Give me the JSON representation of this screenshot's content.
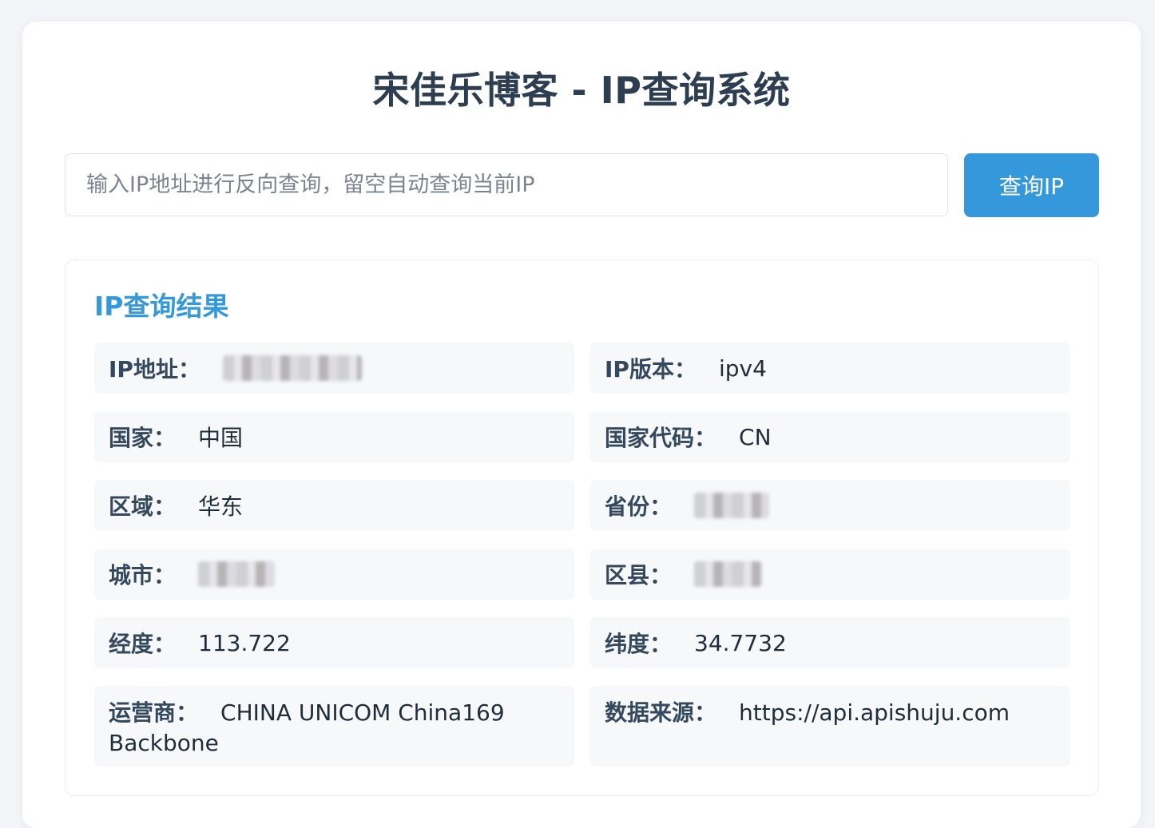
{
  "page": {
    "title": "宋佳乐博客 - IP查询系统"
  },
  "search": {
    "value": "",
    "placeholder": "输入IP地址进行反向查询，留空自动查询当前IP",
    "button_label": "查询IP"
  },
  "result": {
    "title": "IP查询结果",
    "fields": [
      {
        "label": "IP地址：",
        "value": ""
      },
      {
        "label": "IP版本：",
        "value": "ipv4"
      },
      {
        "label": "国家：",
        "value": "中国"
      },
      {
        "label": "国家代码：",
        "value": "CN"
      },
      {
        "label": "区域：",
        "value": "华东"
      },
      {
        "label": "省份：",
        "value": ""
      },
      {
        "label": "城市：",
        "value": ""
      },
      {
        "label": "区县：",
        "value": ""
      },
      {
        "label": "经度：",
        "value": "113.722"
      },
      {
        "label": "纬度：",
        "value": "34.7732"
      },
      {
        "label": "运营商：",
        "value": "CHINA UNICOM China169 Backbone"
      },
      {
        "label": "数据来源：",
        "value": "https://api.apishuju.com"
      }
    ]
  },
  "colors": {
    "background": "#f3f5f8",
    "card": "#ffffff",
    "accent": "#3498db",
    "title": "#2c3e50",
    "cell_background": "#f6f8fa"
  }
}
